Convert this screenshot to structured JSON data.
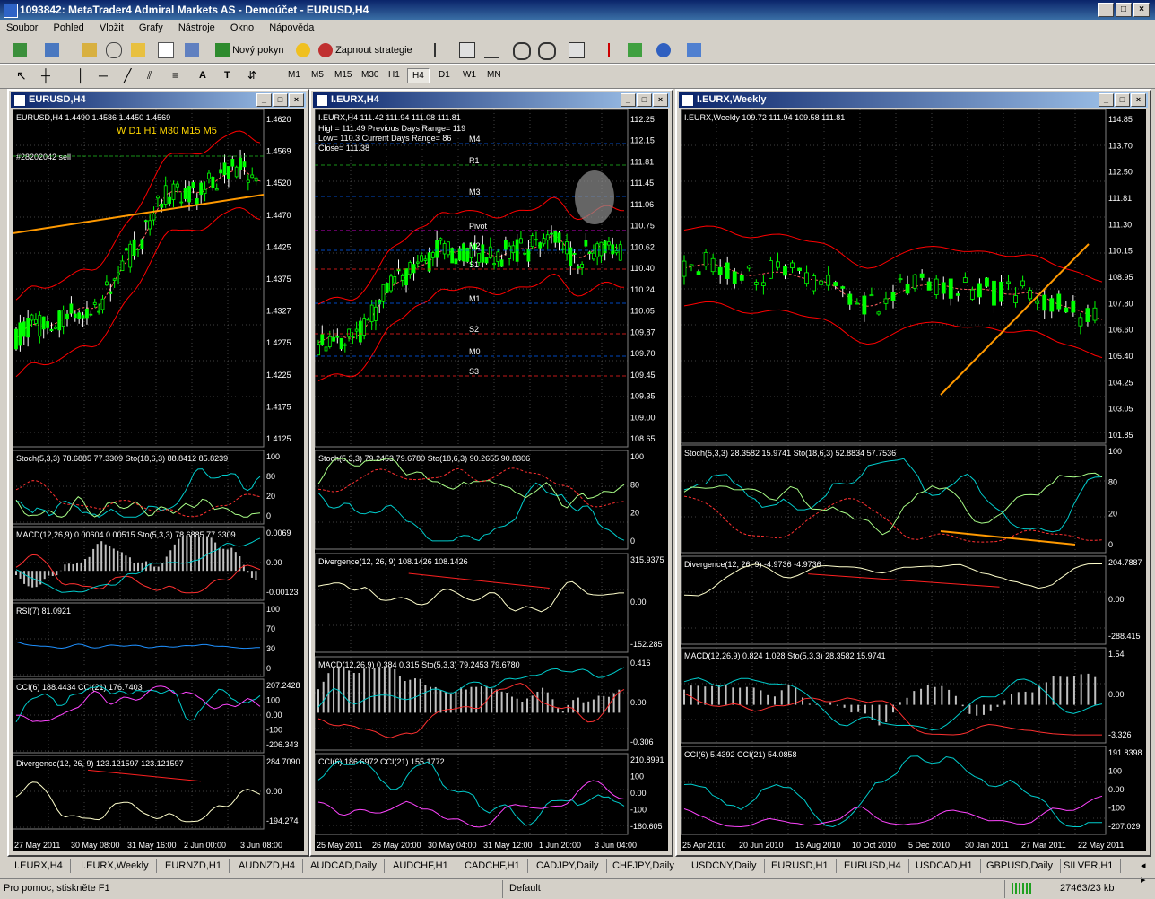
{
  "app": {
    "title": "1093842: MetaTrader4 Admiral Markets AS - Demoúčet - EURUSD,H4"
  },
  "menu": [
    "Soubor",
    "Pohled",
    "Vložit",
    "Grafy",
    "Nástroje",
    "Okno",
    "Nápověda"
  ],
  "toolbar": {
    "new_order": "Nový pokyn",
    "strategy": "Zapnout strategie"
  },
  "timeframes": [
    "M1",
    "M5",
    "M15",
    "M30",
    "H1",
    "H4",
    "D1",
    "W1",
    "MN"
  ],
  "active_timeframe": "H4",
  "colors": {
    "bg": "#000000",
    "grid": "#808080",
    "candle_up": "#00ff00",
    "candle_down": "#ffffff",
    "band": "#ff0000",
    "orange": "#ff9900",
    "stoch_main": "#aaff88",
    "stoch_sig": "#00cccc",
    "macd_hist": "#c0c0c0",
    "rsi": "#1e90ff",
    "cci_main": "#ff44ff"
  },
  "charts": {
    "eurusd": {
      "window_title": "EURUSD,H4",
      "header": "EURUSD,H4  1.4490 1.4586 1.4450 1.4569",
      "tf_row": "W   D1   H1   M30  M15  M5",
      "order_label": "#28202042 sell",
      "price_labels": [
        "1.4620",
        "1.4569",
        "1.4520",
        "1.4470",
        "1.4425",
        "1.4375",
        "1.4327",
        "1.4275",
        "1.4225",
        "1.4175",
        "1.4125"
      ],
      "stoch": {
        "label": "Stoch(5,3,3) 78.6885 77.3309  Sto(18,6,3) 88.8412 85.8239",
        "scale": [
          "100",
          "80",
          "20",
          "0"
        ]
      },
      "macd": {
        "label": "MACD(12,26,9) 0.00604 0.00515  Sto(5,3,3) 78.6885 77.3309",
        "scale": [
          "0.0069",
          "0.00",
          "-0.00123"
        ]
      },
      "rsi": {
        "label": "RSI(7) 81.0921",
        "scale": [
          "100",
          "70",
          "30",
          "0"
        ]
      },
      "cci": {
        "label": "CCI(6) 188.4434  CCI(21) 176.7403",
        "scale": [
          "207.2428",
          "100",
          "0.00",
          "-100",
          "-206.343"
        ]
      },
      "div": {
        "label": "Divergence(12, 26, 9) 123.121597 123.121597",
        "scale": [
          "284.7090",
          "0.00",
          "-194.274"
        ]
      },
      "x_labels": [
        "27 May 2011",
        "30 May 08:00",
        "31 May 16:00",
        "2 Jun 00:00",
        "3 Jun 08:00"
      ]
    },
    "eurx_h4": {
      "window_title": "I.EURX,H4",
      "header": "I.EURX,H4  111.42 111.94 111.08 111.81",
      "info": [
        "High= 111.49    Previous Days Range= 119",
        "Low= 110.3    Current Days Range= 86",
        "Close= 111.38"
      ],
      "pivots": [
        "M4",
        "R1",
        "M3",
        "Pivot",
        "M2",
        "S1",
        "M1",
        "S2",
        "M0",
        "S3"
      ],
      "price_labels": [
        "112.25",
        "112.15",
        "111.81",
        "111.45",
        "111.06",
        "110.75",
        "110.62",
        "110.40",
        "110.24",
        "110.05",
        "109.87",
        "109.70",
        "109.45",
        "109.35",
        "109.00",
        "108.65"
      ],
      "stoch": {
        "label": "Stoch(5,3,3) 79.2453 79.6780  Sto(18,6,3) 90.2655 90.8306",
        "scale": [
          "100",
          "80",
          "20",
          "0"
        ]
      },
      "div": {
        "label": "Divergence(12, 26, 9) 108.1426 108.1426",
        "scale": [
          "315.9375",
          "0.00",
          "-152.285"
        ]
      },
      "macd": {
        "label": "MACD(12,26,9) 0.384 0.315  Sto(5,3,3) 79.2453 79.6780",
        "scale": [
          "0.416",
          "0.00",
          "-0.306"
        ]
      },
      "cci": {
        "label": "CCI(6) 186.6972  CCI(21) 155.1772",
        "scale": [
          "210.8991",
          "100",
          "0.00",
          "-100",
          "-180.605"
        ]
      },
      "x_labels": [
        "25 May 2011",
        "26 May 20:00",
        "30 May 04:00",
        "31 May 12:00",
        "1 Jun 20:00",
        "3 Jun 04:00"
      ]
    },
    "eurx_weekly": {
      "window_title": "I.EURX,Weekly",
      "header": "I.EURX,Weekly  109.72 111.94 109.58 111.81",
      "price_labels": [
        "114.85",
        "113.70",
        "112.50",
        "111.81",
        "111.30",
        "110.15",
        "108.95",
        "107.80",
        "106.60",
        "105.40",
        "104.25",
        "103.05",
        "101.85"
      ],
      "stoch": {
        "label": "Stoch(5,3,3) 28.3582 15.9741  Sto(18,6,3) 52.8834 57.7536",
        "scale": [
          "100",
          "80",
          "20",
          "0"
        ]
      },
      "div": {
        "label": "Divergence(12, 26, 9) -4.9736 -4.9736",
        "scale": [
          "204.7887",
          "0.00",
          "-288.415"
        ]
      },
      "macd": {
        "label": "MACD(12,26,9) 0.824 1.028  Sto(5,3,3) 28.3582 15.9741",
        "scale": [
          "1.54",
          "0.00",
          "-3.326"
        ]
      },
      "cci": {
        "label": "CCI(6) 5.4392  CCI(21) 54.0858",
        "scale": [
          "191.8398",
          "100",
          "0.00",
          "-100",
          "-207.029"
        ]
      },
      "x_labels": [
        "25 Apr 2010",
        "20 Jun 2010",
        "15 Aug 2010",
        "10 Oct 2010",
        "5 Dec 2010",
        "30 Jan 2011",
        "27 Mar 2011",
        "22 May 2011"
      ]
    }
  },
  "tabs": [
    "I.EURX,H4",
    "I.EURX,Weekly",
    "EURNZD,H1",
    "AUDNZD,H4",
    "AUDCAD,Daily",
    "AUDCHF,H1",
    "CADCHF,H1",
    "CADJPY,Daily",
    "CHFJPY,Daily",
    "USDCNY,Daily",
    "EURUSD,H1",
    "EURUSD,H4",
    "USDCAD,H1",
    "GBPUSD,Daily",
    "SILVER,H1"
  ],
  "status": {
    "help": "Pro pomoc, stiskněte F1",
    "profile": "Default",
    "traffic": "27463/23 kb"
  }
}
